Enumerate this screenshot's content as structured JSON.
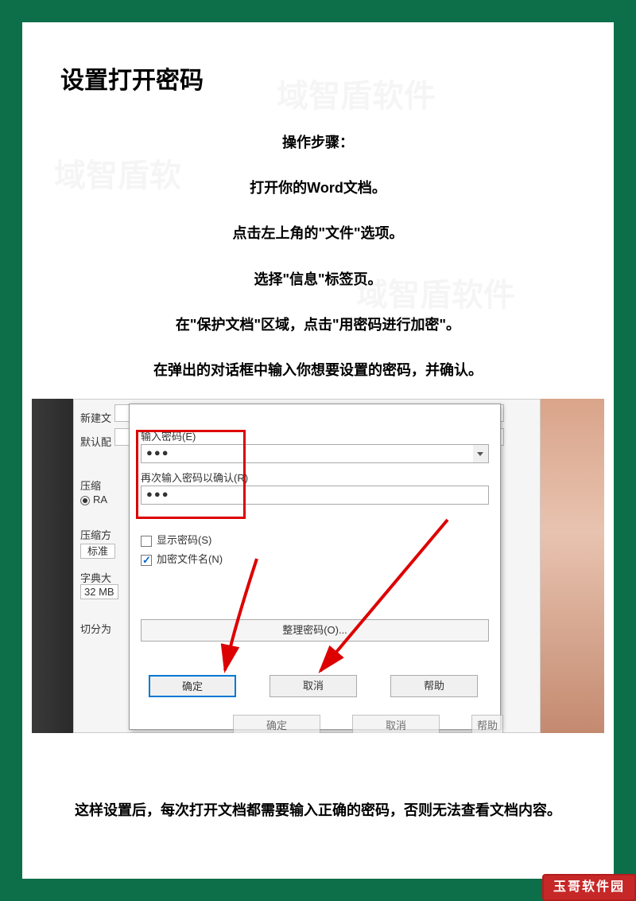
{
  "title": "设置打开密码",
  "steps_header": "操作步骤：",
  "steps": [
    "打开你的Word文档。",
    "点击左上角的\"文件\"选项。",
    "选择\"信息\"标签页。",
    "在\"保护文档\"区域，点击\"用密码进行加密\"。",
    "在弹出的对话框中输入你想要设置的密码，并确认。"
  ],
  "back_panel": {
    "row1": "新建文",
    "row2": "默认配",
    "row3_label": "压缩",
    "row3_radio": "RA",
    "row4_label": "压缩方",
    "row4_value": "标准",
    "row5_label": "字典大",
    "row5_value": "32 MB",
    "row6_label": "切分为"
  },
  "dialog": {
    "pwd_label": "输入密码(E)",
    "pwd_value": "●●●",
    "confirm_label": "再次输入密码以确认(R)",
    "confirm_value": "●●●",
    "show_pwd": "显示密码(S)",
    "encrypt_name": "加密文件名(N)",
    "organize": "整理密码(O)...",
    "ok": "确定",
    "cancel": "取消",
    "help": "帮助",
    "ok2": "确定",
    "cancel2": "取消",
    "help2": "帮助"
  },
  "conclusion": "这样设置后，每次打开文档都需要输入正确的密码，否则无法查看文档内容。",
  "stamp": "玉哥软件园"
}
